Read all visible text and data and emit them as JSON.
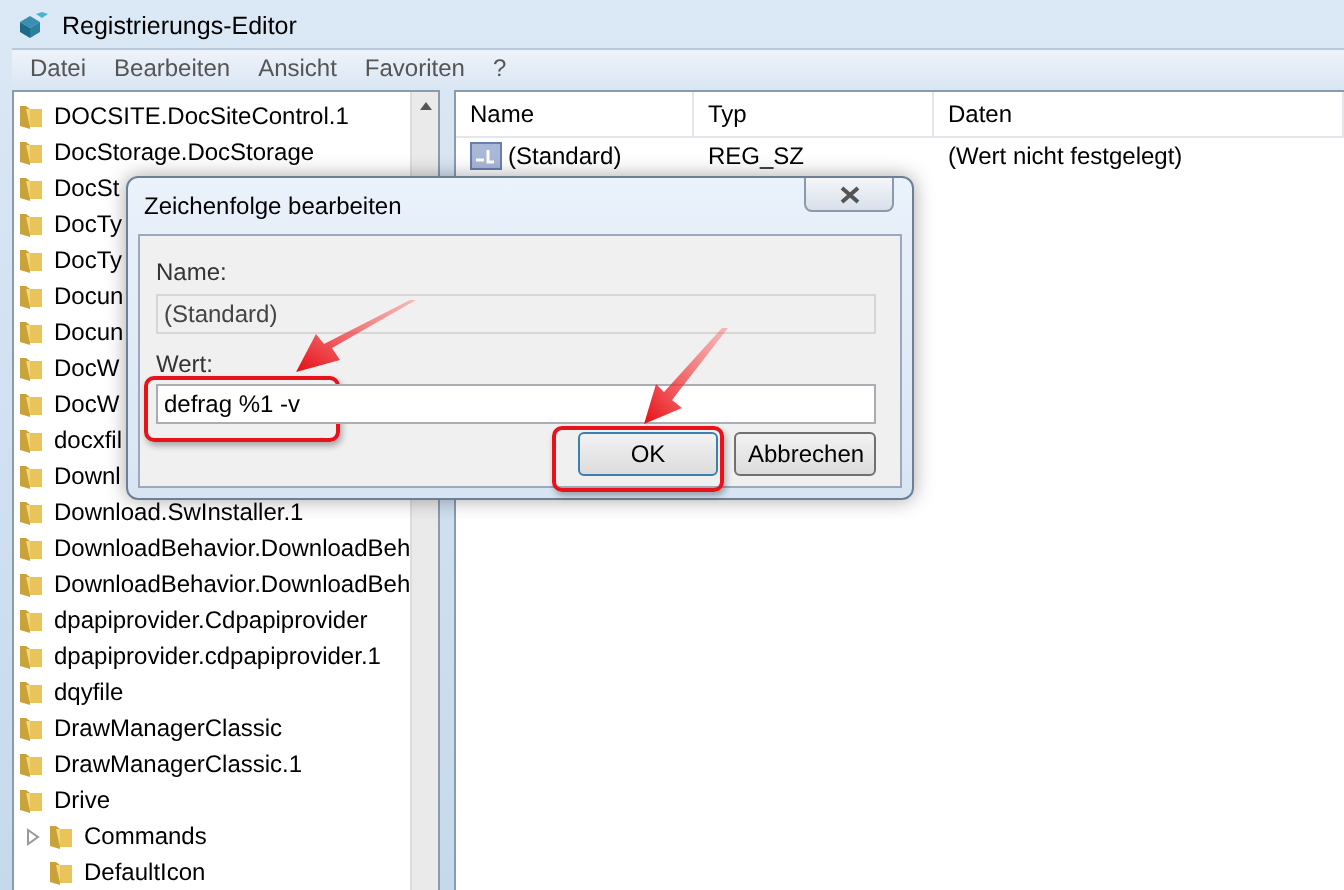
{
  "window": {
    "title": "Registrierungs-Editor"
  },
  "menu": [
    "Datei",
    "Bearbeiten",
    "Ansicht",
    "Favoriten",
    "?"
  ],
  "tree": [
    {
      "label": "DOCSITE.DocSiteControl.1"
    },
    {
      "label": "DocStorage.DocStorage"
    },
    {
      "label": "DocSt"
    },
    {
      "label": "DocTy"
    },
    {
      "label": "DocTy"
    },
    {
      "label": "Docun"
    },
    {
      "label": "Docun"
    },
    {
      "label": "DocW"
    },
    {
      "label": "DocW"
    },
    {
      "label": "docxfil"
    },
    {
      "label": "Downl"
    },
    {
      "label": "Download.SwInstaller.1"
    },
    {
      "label": "DownloadBehavior.DownloadBeh"
    },
    {
      "label": "DownloadBehavior.DownloadBeh"
    },
    {
      "label": "dpapiprovider.Cdpapiprovider"
    },
    {
      "label": "dpapiprovider.cdpapiprovider.1"
    },
    {
      "label": "dqyfile"
    },
    {
      "label": "DrawManagerClassic"
    },
    {
      "label": "DrawManagerClassic.1"
    },
    {
      "label": "Drive",
      "children": [
        {
          "label": "Commands",
          "expandable": true
        },
        {
          "label": "DefaultIcon",
          "expandable": false
        }
      ]
    }
  ],
  "values": {
    "columns": [
      "Name",
      "Typ",
      "Daten"
    ],
    "rows": [
      {
        "name": "(Standard)",
        "type": "REG_SZ",
        "data": "(Wert nicht festgelegt)"
      }
    ]
  },
  "dialog": {
    "title": "Zeichenfolge bearbeiten",
    "name_label": "Name:",
    "name_value": "(Standard)",
    "value_label": "Wert:",
    "value": "defrag %1 -v",
    "buttons": [
      {
        "label": "OK",
        "default": true
      },
      {
        "label": "Abbrechen",
        "default": false
      }
    ]
  }
}
